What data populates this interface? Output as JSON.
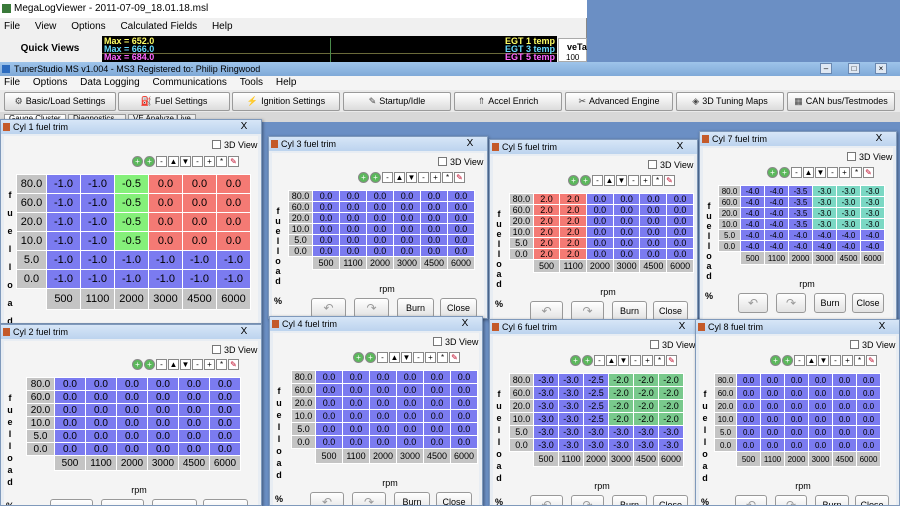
{
  "mlv": {
    "title": "MegaLogViewer - 2011-07-09_18.01.18.msl",
    "menu": [
      "File",
      "View",
      "Options",
      "Calculated Fields",
      "Help"
    ],
    "quick_views": "Quick Views",
    "graph": {
      "max1": "Max = 652.0",
      "max2": "Max = 666.0",
      "max3": "Max = 684.0",
      "egt1": "EGT 1 temp",
      "egt3": "EGT 3 temp",
      "egt5": "EGT 5 temp",
      "colors": {
        "max1": "#ffff66",
        "max2": "#66ddff",
        "max3": "#ff66ff",
        "egt1": "#ffff66",
        "egt3": "#66ddff",
        "egt5": "#ff66ff"
      }
    },
    "ve_tab": "veTa",
    "ve_val": "100"
  },
  "ts": {
    "title": "TunerStudio MS v1.004 - MS3 Registered to: Philip Ringwood",
    "menu": [
      "File",
      "Options",
      "Data Logging",
      "Communications",
      "Tools",
      "Help"
    ],
    "toolbar": [
      {
        "label": "Basic/Load Settings",
        "icon": "settings-icon"
      },
      {
        "label": "Fuel Settings",
        "icon": "fuel-icon"
      },
      {
        "label": "Ignition Settings",
        "icon": "spark-icon"
      },
      {
        "label": "Startup/Idle",
        "icon": "wrench-icon"
      },
      {
        "label": "Accel Enrich",
        "icon": "accel-icon"
      },
      {
        "label": "Advanced Engine",
        "icon": "engine-icon"
      },
      {
        "label": "3D Tuning Maps",
        "icon": "map-icon"
      },
      {
        "label": "CAN bus/Testmodes",
        "icon": "can-icon"
      }
    ],
    "tabs": [
      "Gauge Cluster",
      "Diagnostics",
      "VE Analyze Live"
    ]
  },
  "common": {
    "view3d": "3D View",
    "y_axis_label": [
      "f",
      "u",
      "e",
      "l",
      "l",
      "o",
      "a",
      "d",
      "",
      "%"
    ],
    "x_axis_title": "rpm",
    "burn": "Burn",
    "close": "Close",
    "tools": [
      "+",
      "+",
      "-",
      "▲",
      "▼",
      "-",
      "+",
      "*",
      "✎"
    ]
  },
  "windows": [
    {
      "title": "Cyl 1 fuel trim",
      "close": "X",
      "y": [
        "80.0",
        "60.0",
        "20.0",
        "10.0",
        "5.0",
        "0.0"
      ],
      "x": [
        "500",
        "1100",
        "2000",
        "3000",
        "4500",
        "6000"
      ],
      "cells": [
        [
          "-1.0",
          "-1.0",
          "-0.5",
          "0.0",
          "0.0",
          "0.0"
        ],
        [
          "-1.0",
          "-1.0",
          "-0.5",
          "0.0",
          "0.0",
          "0.0"
        ],
        [
          "-1.0",
          "-1.0",
          "-0.5",
          "0.0",
          "0.0",
          "0.0"
        ],
        [
          "-1.0",
          "-1.0",
          "-0.5",
          "0.0",
          "0.0",
          "0.0"
        ],
        [
          "-1.0",
          "-1.0",
          "-1.0",
          "-1.0",
          "-1.0",
          "-1.0"
        ],
        [
          "-1.0",
          "-1.0",
          "-1.0",
          "-1.0",
          "-1.0",
          "-1.0"
        ]
      ],
      "colors": [
        [
          "b",
          "b",
          "gg",
          "r",
          "r",
          "r"
        ],
        [
          "b",
          "b",
          "gg",
          "r",
          "r",
          "r"
        ],
        [
          "b",
          "b",
          "gg",
          "r",
          "r",
          "r"
        ],
        [
          "b",
          "b",
          "gg",
          "r",
          "r",
          "r"
        ],
        [
          "b",
          "b",
          "b",
          "b",
          "b",
          "b"
        ],
        [
          "b",
          "b",
          "b",
          "b",
          "b",
          "b"
        ]
      ]
    },
    {
      "title": "Cyl 3 fuel trim",
      "close": "X",
      "y": [
        "80.0",
        "60.0",
        "20.0",
        "10.0",
        "5.0",
        "0.0"
      ],
      "x": [
        "500",
        "1100",
        "2000",
        "3000",
        "4500",
        "6000"
      ],
      "cells": [
        [
          "0.0",
          "0.0",
          "0.0",
          "0.0",
          "0.0",
          "0.0"
        ],
        [
          "0.0",
          "0.0",
          "0.0",
          "0.0",
          "0.0",
          "0.0"
        ],
        [
          "0.0",
          "0.0",
          "0.0",
          "0.0",
          "0.0",
          "0.0"
        ],
        [
          "0.0",
          "0.0",
          "0.0",
          "0.0",
          "0.0",
          "0.0"
        ],
        [
          "0.0",
          "0.0",
          "0.0",
          "0.0",
          "0.0",
          "0.0"
        ],
        [
          "0.0",
          "0.0",
          "0.0",
          "0.0",
          "0.0",
          "0.0"
        ]
      ],
      "colors": "b"
    },
    {
      "title": "Cyl 5 fuel trim",
      "close": "X",
      "y": [
        "80.0",
        "60.0",
        "20.0",
        "10.0",
        "5.0",
        "0.0"
      ],
      "x": [
        "500",
        "1100",
        "2000",
        "3000",
        "4500",
        "6000"
      ],
      "cells": [
        [
          "2.0",
          "2.0",
          "0.0",
          "0.0",
          "0.0",
          "0.0"
        ],
        [
          "2.0",
          "2.0",
          "0.0",
          "0.0",
          "0.0",
          "0.0"
        ],
        [
          "2.0",
          "2.0",
          "0.0",
          "0.0",
          "0.0",
          "0.0"
        ],
        [
          "2.0",
          "2.0",
          "0.0",
          "0.0",
          "0.0",
          "0.0"
        ],
        [
          "2.0",
          "2.0",
          "0.0",
          "0.0",
          "0.0",
          "0.0"
        ],
        [
          "2.0",
          "2.0",
          "0.0",
          "0.0",
          "0.0",
          "0.0"
        ]
      ],
      "colors": [
        [
          "r",
          "r",
          "b",
          "b",
          "b",
          "b"
        ],
        [
          "r",
          "r",
          "b",
          "b",
          "b",
          "b"
        ],
        [
          "r",
          "r",
          "b",
          "b",
          "b",
          "b"
        ],
        [
          "r",
          "r",
          "b",
          "b",
          "b",
          "b"
        ],
        [
          "r",
          "r",
          "b",
          "b",
          "b",
          "b"
        ],
        [
          "r",
          "r",
          "b",
          "b",
          "b",
          "b"
        ]
      ]
    },
    {
      "title": "Cyl 7 fuel trim",
      "close": "X",
      "y": [
        "80.0",
        "60.0",
        "20.0",
        "10.0",
        "5.0",
        "0.0"
      ],
      "x": [
        "500",
        "1100",
        "2000",
        "3000",
        "4500",
        "6000"
      ],
      "cells": [
        [
          "-4.0",
          "-4.0",
          "-3.5",
          "-3.0",
          "-3.0",
          "-3.0"
        ],
        [
          "-4.0",
          "-4.0",
          "-3.5",
          "-3.0",
          "-3.0",
          "-3.0"
        ],
        [
          "-4.0",
          "-4.0",
          "-3.5",
          "-3.0",
          "-3.0",
          "-3.0"
        ],
        [
          "-4.0",
          "-4.0",
          "-3.5",
          "-3.0",
          "-3.0",
          "-3.0"
        ],
        [
          "-4.0",
          "-4.0",
          "-4.0",
          "-4.0",
          "-4.0",
          "-4.0"
        ],
        [
          "-4.0",
          "-4.0",
          "-4.0",
          "-4.0",
          "-4.0",
          "-4.0"
        ]
      ],
      "colors": [
        [
          "b",
          "b",
          "b",
          "t",
          "t",
          "t"
        ],
        [
          "b",
          "b",
          "b",
          "t",
          "t",
          "t"
        ],
        [
          "b",
          "b",
          "b",
          "t",
          "t",
          "t"
        ],
        [
          "b",
          "b",
          "b",
          "t",
          "t",
          "t"
        ],
        [
          "b",
          "b",
          "b",
          "b",
          "b",
          "b"
        ],
        [
          "b",
          "b",
          "b",
          "b",
          "b",
          "b"
        ]
      ]
    },
    {
      "title": "Cyl 2 fuel trim",
      "close": "X",
      "y": [
        "80.0",
        "60.0",
        "20.0",
        "10.0",
        "5.0",
        "0.0"
      ],
      "x": [
        "500",
        "1100",
        "2000",
        "3000",
        "4500",
        "6000"
      ],
      "cells": [
        [
          "0.0",
          "0.0",
          "0.0",
          "0.0",
          "0.0",
          "0.0"
        ],
        [
          "0.0",
          "0.0",
          "0.0",
          "0.0",
          "0.0",
          "0.0"
        ],
        [
          "0.0",
          "0.0",
          "0.0",
          "0.0",
          "0.0",
          "0.0"
        ],
        [
          "0.0",
          "0.0",
          "0.0",
          "0.0",
          "0.0",
          "0.0"
        ],
        [
          "0.0",
          "0.0",
          "0.0",
          "0.0",
          "0.0",
          "0.0"
        ],
        [
          "0.0",
          "0.0",
          "0.0",
          "0.0",
          "0.0",
          "0.0"
        ]
      ],
      "colors": "b"
    },
    {
      "title": "Cyl 4 fuel trim",
      "close": "X",
      "y": [
        "80.0",
        "60.0",
        "20.0",
        "10.0",
        "5.0",
        "0.0"
      ],
      "x": [
        "500",
        "1100",
        "2000",
        "3000",
        "4500",
        "6000"
      ],
      "cells": [
        [
          "0.0",
          "0.0",
          "0.0",
          "0.0",
          "0.0",
          "0.0"
        ],
        [
          "0.0",
          "0.0",
          "0.0",
          "0.0",
          "0.0",
          "0.0"
        ],
        [
          "0.0",
          "0.0",
          "0.0",
          "0.0",
          "0.0",
          "0.0"
        ],
        [
          "0.0",
          "0.0",
          "0.0",
          "0.0",
          "0.0",
          "0.0"
        ],
        [
          "0.0",
          "0.0",
          "0.0",
          "0.0",
          "0.0",
          "0.0"
        ],
        [
          "0.0",
          "0.0",
          "0.0",
          "0.0",
          "0.0",
          "0.0"
        ]
      ],
      "colors": "b"
    },
    {
      "title": "Cyl 6 fuel trim",
      "close": "X",
      "y": [
        "80.0",
        "60.0",
        "20.0",
        "10.0",
        "5.0",
        "0.0"
      ],
      "x": [
        "500",
        "1100",
        "2000",
        "3000",
        "4500",
        "6000"
      ],
      "cells": [
        [
          "-3.0",
          "-3.0",
          "-2.5",
          "-2.0",
          "-2.0",
          "-2.0"
        ],
        [
          "-3.0",
          "-3.0",
          "-2.5",
          "-2.0",
          "-2.0",
          "-2.0"
        ],
        [
          "-3.0",
          "-3.0",
          "-2.5",
          "-2.0",
          "-2.0",
          "-2.0"
        ],
        [
          "-3.0",
          "-3.0",
          "-2.5",
          "-2.0",
          "-2.0",
          "-2.0"
        ],
        [
          "-3.0",
          "-3.0",
          "-3.0",
          "-3.0",
          "-3.0",
          "-3.0"
        ],
        [
          "-3.0",
          "-3.0",
          "-3.0",
          "-3.0",
          "-3.0",
          "-3.0"
        ]
      ],
      "colors": [
        [
          "b",
          "b",
          "b",
          "g",
          "g",
          "g"
        ],
        [
          "b",
          "b",
          "b",
          "g",
          "g",
          "g"
        ],
        [
          "b",
          "b",
          "b",
          "g",
          "g",
          "g"
        ],
        [
          "b",
          "b",
          "b",
          "g",
          "g",
          "g"
        ],
        [
          "b",
          "b",
          "b",
          "b",
          "b",
          "b"
        ],
        [
          "b",
          "b",
          "b",
          "b",
          "b",
          "b"
        ]
      ]
    },
    {
      "title": "Cyl 8 fuel trim",
      "close": "X",
      "y": [
        "80.0",
        "60.0",
        "20.0",
        "10.0",
        "5.0",
        "0.0"
      ],
      "x": [
        "500",
        "1100",
        "2000",
        "3000",
        "4500",
        "6000"
      ],
      "cells": [
        [
          "0.0",
          "0.0",
          "0.0",
          "0.0",
          "0.0",
          "0.0"
        ],
        [
          "0.0",
          "0.0",
          "0.0",
          "0.0",
          "0.0",
          "0.0"
        ],
        [
          "0.0",
          "0.0",
          "0.0",
          "0.0",
          "0.0",
          "0.0"
        ],
        [
          "0.0",
          "0.0",
          "0.0",
          "0.0",
          "0.0",
          "0.0"
        ],
        [
          "0.0",
          "0.0",
          "0.0",
          "0.0",
          "0.0",
          "0.0"
        ],
        [
          "0.0",
          "0.0",
          "0.0",
          "0.0",
          "0.0",
          "0.0"
        ]
      ],
      "colors": "b"
    }
  ]
}
